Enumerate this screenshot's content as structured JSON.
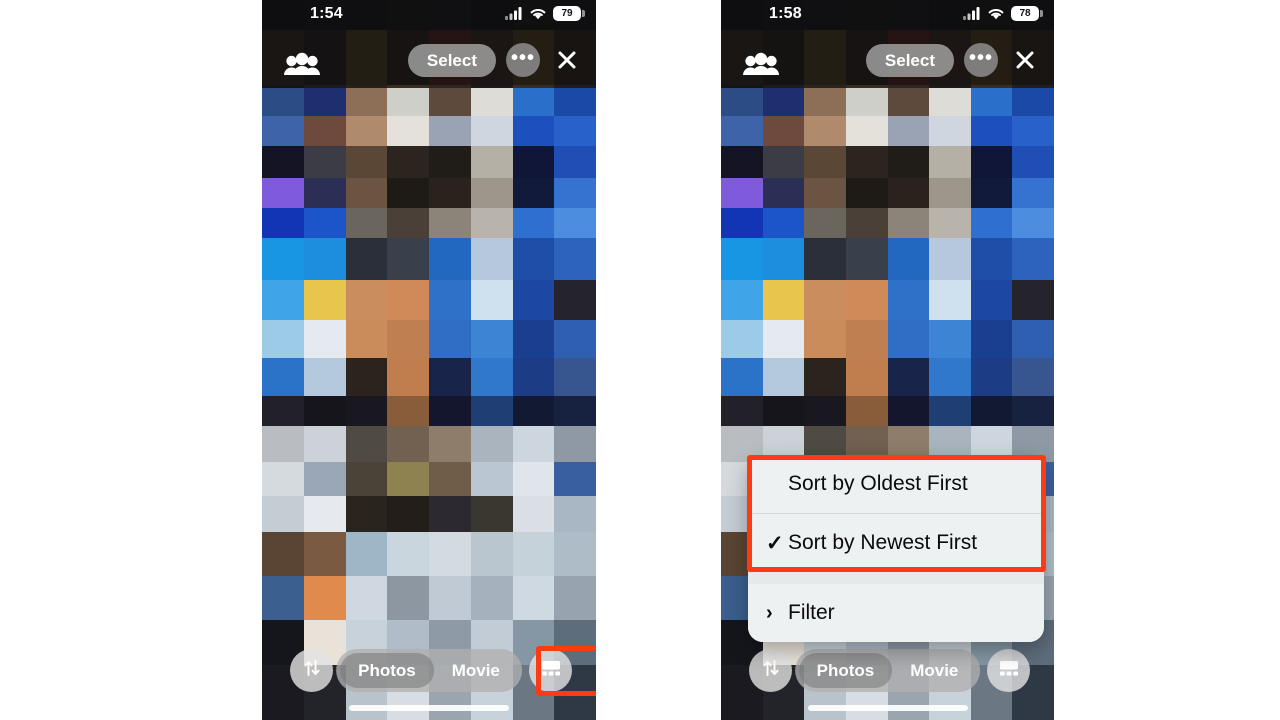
{
  "phones": [
    {
      "id": "phone-before",
      "status": {
        "time": "1:54",
        "cellular_icon": "cellular-signal-icon",
        "wifi_icon": "wifi-icon",
        "battery_level": "79",
        "battery_icon": "battery-icon"
      },
      "nav": {
        "people_icon": "people-group-icon",
        "select_label": "Select",
        "more_icon": "more-ellipsis-icon",
        "close_icon": "close-x-icon"
      },
      "toolbar": {
        "sort_icon": "sort-arrows-icon",
        "segments": [
          {
            "label": "Photos",
            "active": true
          },
          {
            "label": "Movie",
            "active": false
          }
        ],
        "layout_icon": "grid-layout-icon"
      },
      "menu_open": false,
      "highlight": "sort-button"
    },
    {
      "id": "phone-after",
      "status": {
        "time": "1:58",
        "cellular_icon": "cellular-signal-icon",
        "wifi_icon": "wifi-icon",
        "battery_level": "78",
        "battery_icon": "battery-icon"
      },
      "nav": {
        "people_icon": "people-group-icon",
        "select_label": "Select",
        "more_icon": "more-ellipsis-icon",
        "close_icon": "close-x-icon"
      },
      "toolbar": {
        "sort_icon": "sort-arrows-icon",
        "segments": [
          {
            "label": "Photos",
            "active": true
          },
          {
            "label": "Movie",
            "active": false
          }
        ],
        "layout_icon": "grid-layout-icon"
      },
      "menu_open": true,
      "menu": {
        "items": [
          {
            "label": "Sort by Oldest First",
            "checked": false,
            "chevron": false
          },
          {
            "label": "Sort by Newest First",
            "checked": true,
            "chevron": false
          },
          {
            "label": "Filter",
            "checked": false,
            "chevron": true
          }
        ],
        "check_glyph": "✓",
        "chevron_glyph": "›"
      },
      "highlight": "sort-options-group"
    }
  ],
  "colors": {
    "highlight": "#fa3c14",
    "menu_bg": "#eef1f2",
    "bar_bg": "#0e0e10"
  }
}
